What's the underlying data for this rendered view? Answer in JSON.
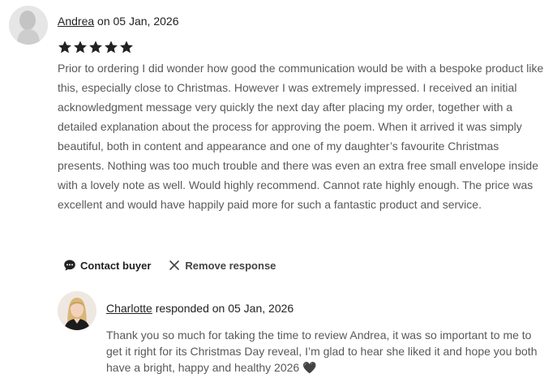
{
  "review": {
    "author": "Andrea",
    "date_prefix": " on ",
    "date": "05 Jan, 2026",
    "rating": 5,
    "rating_max": 5,
    "text": "Prior to ordering I did wonder how good the communication would be with a bespoke product like this, especially close to Christmas. However I was extremely impressed. I received an initial acknowledgment message very quickly the next day after placing my order, together with a detailed explanation about the process for approving the poem. When it arrived it was simply beautiful, both in content and appearance and one of my daughter’s favourite Christmas presents. Nothing was too much trouble and there was even an extra free small envelope inside with a lovely note as well. Would highly recommend. Cannot rate highly enough. The price was excellent and would have happily paid more for such a fantastic product and service."
  },
  "actions": {
    "contact_buyer": "Contact buyer",
    "remove_response": "Remove response"
  },
  "response": {
    "author": "Charlotte",
    "date_prefix": " responded on ",
    "date": "05 Jan, 2026",
    "text": "Thank you so much for taking the time to review Andrea, it was so important to me to get it right for its Christmas Day reveal, I’m glad to hear she liked it and hope you both have a bright, happy and healthy 2026 🖤"
  },
  "icons": {
    "star": "star-icon",
    "contact": "chat-bubble-icon",
    "remove": "close-icon"
  },
  "colors": {
    "text_primary": "#222222",
    "text_secondary": "#595959",
    "star": "#222222"
  }
}
